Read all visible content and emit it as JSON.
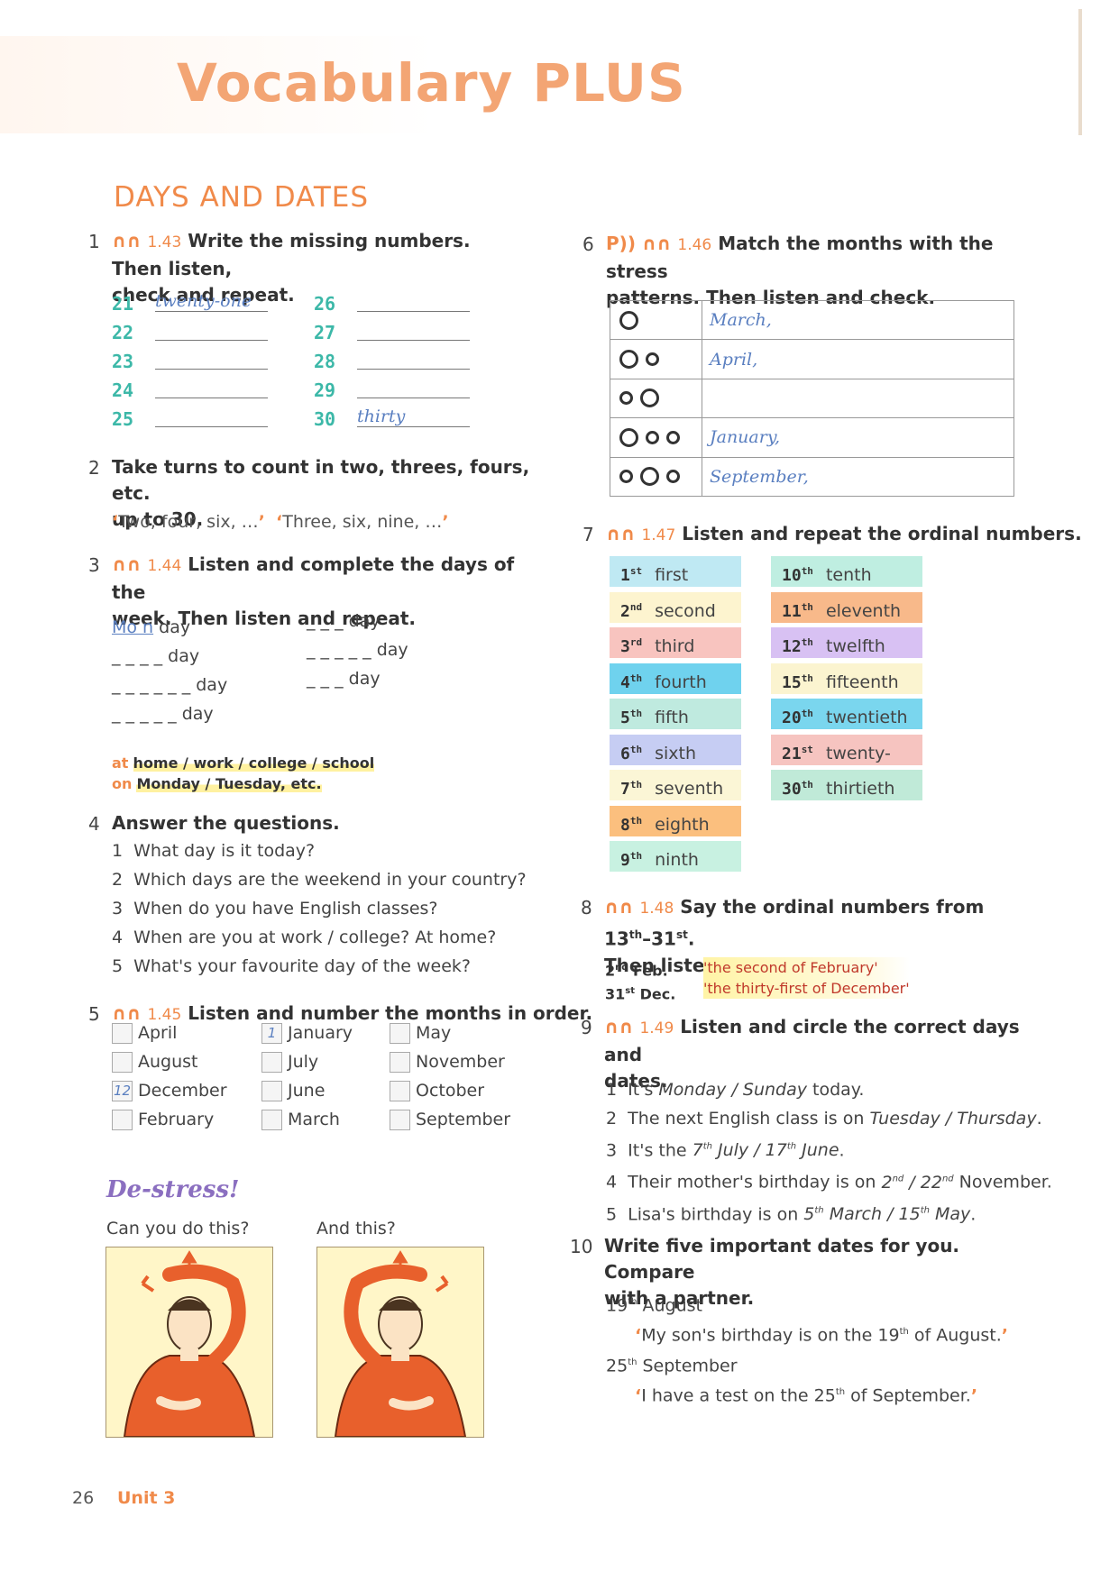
{
  "header": {
    "title": "Vocabulary PLUS"
  },
  "section": {
    "title": "DAYS AND DATES"
  },
  "ex1": {
    "num": "1",
    "ref": "1.43",
    "text1": "Write the missing numbers. Then listen,",
    "text2": "check and repeat.",
    "left": [
      {
        "n": "21",
        "a": "twenty-one"
      },
      {
        "n": "22",
        "a": ""
      },
      {
        "n": "23",
        "a": ""
      },
      {
        "n": "24",
        "a": ""
      },
      {
        "n": "25",
        "a": ""
      }
    ],
    "right": [
      {
        "n": "26",
        "a": ""
      },
      {
        "n": "27",
        "a": ""
      },
      {
        "n": "28",
        "a": ""
      },
      {
        "n": "29",
        "a": ""
      },
      {
        "n": "30",
        "a": "thirty"
      }
    ]
  },
  "ex2": {
    "num": "2",
    "text1": "Take turns to count in two, threes, fours, etc.",
    "text2": "up to 30.",
    "q1": "Two, four, six, …",
    "q2": "Three, six, nine, …"
  },
  "ex3": {
    "num": "3",
    "ref": "1.44",
    "text1": "Listen and complete the days of the",
    "text2": "week. Then listen and repeat.",
    "left": [
      {
        "pre": "Mo n",
        "suf": " day"
      },
      {
        "pre": "_ _ _ _",
        "suf": " day"
      },
      {
        "pre": "_ _ _ _ _ _",
        "suf": " day"
      },
      {
        "pre": "_ _ _ _ _",
        "suf": " day"
      }
    ],
    "right": [
      {
        "pre": "_ _ _",
        "suf": " day"
      },
      {
        "pre": "_ _ _ _ _",
        "suf": " day"
      },
      {
        "pre": "_ _ _",
        "suf": " day"
      }
    ],
    "note1a": "at",
    "note1b": "home / work / college / school",
    "note2a": "on",
    "note2b": "Monday / Tuesday, etc."
  },
  "ex4": {
    "num": "4",
    "text": "Answer the questions.",
    "items": [
      "What day is it today?",
      "Which days are the weekend in your country?",
      "When do you have English classes?",
      "When are you at work / college? At home?",
      "What's your favourite day of the week?"
    ]
  },
  "ex5": {
    "num": "5",
    "ref": "1.45",
    "text": "Listen and number the months in order.",
    "col1": [
      {
        "m": "April",
        "v": ""
      },
      {
        "m": "August",
        "v": ""
      },
      {
        "m": "December",
        "v": "12"
      },
      {
        "m": "February",
        "v": ""
      }
    ],
    "col2": [
      {
        "m": "January",
        "v": "1"
      },
      {
        "m": "July",
        "v": ""
      },
      {
        "m": "June",
        "v": ""
      },
      {
        "m": "March",
        "v": ""
      }
    ],
    "col3": [
      {
        "m": "May",
        "v": ""
      },
      {
        "m": "November",
        "v": ""
      },
      {
        "m": "October",
        "v": ""
      },
      {
        "m": "September",
        "v": ""
      }
    ]
  },
  "destress": {
    "title": "De-stress!",
    "c1": "Can you do this?",
    "c2": "And this?"
  },
  "ex6": {
    "num": "6",
    "icon": "P",
    "ref": "1.46",
    "text1": "Match the months with the stress",
    "text2": "patterns. Then listen and check.",
    "rows": [
      {
        "p": "O",
        "a": "March,"
      },
      {
        "p": "Oo",
        "a": "April,"
      },
      {
        "p": "oO",
        "a": ""
      },
      {
        "p": "Ooo",
        "a": "January,"
      },
      {
        "p": "oOo",
        "a": "September,"
      }
    ]
  },
  "ex7": {
    "num": "7",
    "ref": "1.47",
    "text": "Listen and repeat the ordinal numbers.",
    "col1": [
      {
        "n": "1",
        "s": "st",
        "w": "first",
        "c": "#bfe9f3"
      },
      {
        "n": "2",
        "s": "nd",
        "w": "second",
        "c": "#fdf4cf"
      },
      {
        "n": "3",
        "s": "rd",
        "w": "third",
        "c": "#f8c4bf"
      },
      {
        "n": "4",
        "s": "th",
        "w": "fourth",
        "c": "#6fd2ee"
      },
      {
        "n": "5",
        "s": "th",
        "w": "fifth",
        "c": "#bfeadf"
      },
      {
        "n": "6",
        "s": "th",
        "w": "sixth",
        "c": "#c6cdf3"
      },
      {
        "n": "7",
        "s": "th",
        "w": "seventh",
        "c": "#fbf6d6"
      },
      {
        "n": "8",
        "s": "th",
        "w": "eighth",
        "c": "#fbbf7e"
      },
      {
        "n": "9",
        "s": "th",
        "w": "ninth",
        "c": "#c8f1e1"
      }
    ],
    "col2": [
      {
        "n": "10",
        "s": "th",
        "w": "tenth",
        "c": "#bfeee1"
      },
      {
        "n": "11",
        "s": "th",
        "w": "eleventh",
        "c": "#f8b98a"
      },
      {
        "n": "12",
        "s": "th",
        "w": "twelfth",
        "c": "#d8c1f3"
      },
      {
        "n": "15",
        "s": "th",
        "w": "fifteenth",
        "c": "#fbf4d0"
      },
      {
        "n": "20",
        "s": "th",
        "w": "twentieth",
        "c": "#7ad6ee"
      },
      {
        "n": "21",
        "s": "st",
        "w": "twenty-first",
        "c": "#f6c4c0"
      },
      {
        "n": "30",
        "s": "th",
        "w": "thirtieth",
        "c": "#c0ead8"
      }
    ]
  },
  "ex8": {
    "num": "8",
    "ref": "1.48",
    "text1a": "Say the ordinal numbers from 13",
    "text1b": "th",
    "text1c": "–31",
    "text1d": "st",
    "text1e": ".",
    "text2": "Then listen and check.",
    "r1a": "2",
    "r1b": "nd",
    "r1c": " Feb.",
    "r1q": "'the second of February'",
    "r2a": "31",
    "r2b": "st",
    "r2c": " Dec.",
    "r2q": "'the thirty-first of December'"
  },
  "ex9": {
    "num": "9",
    "ref": "1.49",
    "text1": "Listen and circle the correct days and",
    "text2": "dates.",
    "i1a": "It's ",
    "i1b": "Monday / Sunday",
    "i1c": " today.",
    "i2a": "The next English class is on ",
    "i2b": "Tuesday / Thursday",
    "i2c": ".",
    "i3a": "It's the ",
    "i3b": "7",
    "i3s": "th",
    "i3c": " July / 17",
    "i3d": "th",
    "i3e": " June",
    ".": ".",
    "i3f": ".",
    "i4a": "Their mother's birthday is on ",
    "i4b": "2",
    "i4s": "nd",
    "i4c": " / 22",
    "i4d": "nd",
    "i4e": " November.",
    "i5a": "Lisa's birthday is on ",
    "i5b": "5",
    "i5s": "th",
    "i5c": " March / 15",
    "i5d": "th",
    "i5e": " May",
    "i5f": "."
  },
  "ex10": {
    "num": "10",
    "text1": "Write five important dates for you. Compare",
    "text2": "with a partner.",
    "d1a": "19",
    "d1b": "th",
    "d1c": " August",
    "q1a": "My son's birthday is on the 19",
    "q1b": "th",
    "q1c": " of August.",
    "d2a": "25",
    "d2b": "th",
    "d2c": " September",
    "q2a": "I have a test on the 25",
    "q2b": "th",
    "q2c": " of September."
  },
  "footer": {
    "page": "26",
    "unit": "Unit 3"
  }
}
